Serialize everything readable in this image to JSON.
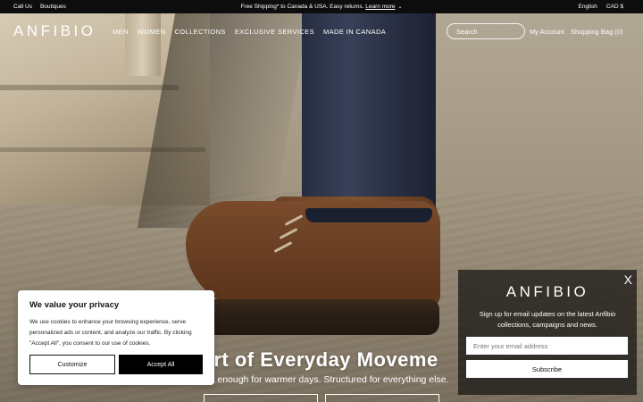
{
  "topbar": {
    "call_us": "Call Us",
    "boutiques": "Boutiques",
    "shipping": "Free Shipping* to Canada & USA. Easy returns.",
    "learn_more": "Learn more",
    "language": "English",
    "currency": "CAD $"
  },
  "header": {
    "logo": "ANFIBIO",
    "nav": [
      "MEN",
      "WOMEN",
      "COLLECTIONS",
      "EXCLUSIVE SERVICES",
      "MADE IN CANADA"
    ],
    "search_placeholder": "Search",
    "account": "My Account",
    "bag": "Shopping Bag (0)"
  },
  "hero": {
    "title": "rt of Everyday Moveme",
    "subtitle": "t enough for warmer days. Structured for everything else."
  },
  "cookie": {
    "title": "We value your privacy",
    "text": "We use cookies to enhance your browsing experience, serve personalized ads or content, and analyze our traffic. By clicking \"Accept All\", you consent to our use of cookies.",
    "customize": "Customize",
    "accept": "Accept All"
  },
  "newsletter": {
    "close": "X",
    "logo": "ANFIBIO",
    "text": "Sign up for email updates on the latest Anfibio collections, campaigns and news.",
    "email_placeholder": "Enter your email address",
    "subscribe": "Subscribe"
  }
}
